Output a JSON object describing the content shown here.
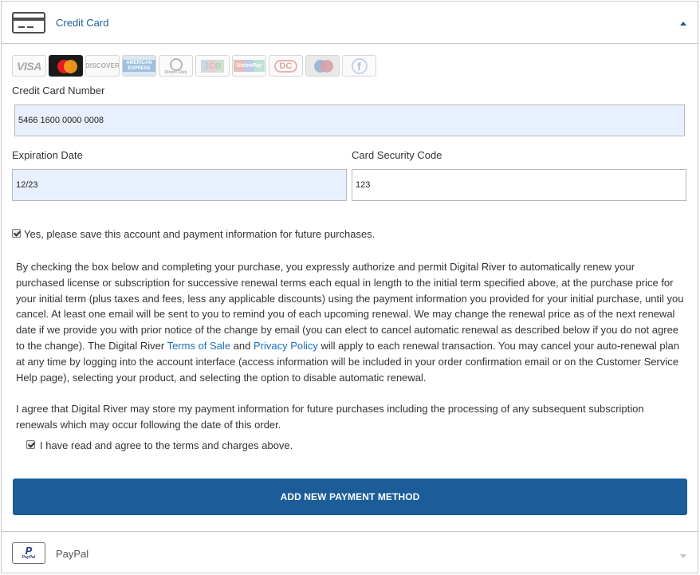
{
  "credit_card": {
    "title": "Credit Card",
    "logos": {
      "visa": "VISA",
      "discover": "DISCOVER",
      "amex": "AMERICAN EXPRESS",
      "diners": "Diners Club",
      "jcb": "JCB",
      "unionpay": "UnionPay",
      "dankort": "DC",
      "f": "f"
    },
    "number_label": "Credit Card Number",
    "number_value": "5466 1600 0000 0008",
    "expiration_label": "Expiration Date",
    "expiration_value": "12/23",
    "security_label": "Card Security Code",
    "security_value": "123",
    "save_checkbox_label": "Yes, please save this account and payment information for future purchases.",
    "save_checked": true
  },
  "terms": {
    "paragraph_part1": "By checking the box below and completing your purchase, you expressly authorize and permit Digital River to automatically renew your purchased license or subscription for successive renewal terms each equal in length to the initial term specified above, at the purchase price for your initial term (plus taxes and fees, less any applicable discounts) using the payment information you provided for your initial purchase, until you cancel. At least one email will be sent to you to remind you of each upcoming renewal. We may change the renewal price as of the next renewal date if we provide you with prior notice of the change by email (you can elect to cancel automatic renewal as described below if you do not agree to the change). The Digital River ",
    "terms_link": "Terms of Sale",
    "and_text": " and ",
    "privacy_link": "Privacy Policy",
    "paragraph_part2": " will apply to each renewal transaction. You may cancel your auto-renewal plan at any time by logging into the account interface (access information will be included in your order confirmation email or on the Customer Service Help page), selecting your product, and selecting the option to disable automatic renewal.",
    "store_paragraph": "I agree that Digital River may store my payment information for future purchases including the processing of any subsequent subscription renewals which may occur following the date of this order.",
    "agree_checkbox_label": "I have read and agree to the terms and charges above.",
    "agree_checked": true
  },
  "add_button_label": "ADD NEW PAYMENT METHOD",
  "paypal": {
    "title": "PayPal",
    "icon_top": "P",
    "icon_text": "PayPal"
  },
  "colors": {
    "accent": "#1a5d98",
    "link": "#1d6fb8",
    "autofill": "#e8f0fe"
  }
}
